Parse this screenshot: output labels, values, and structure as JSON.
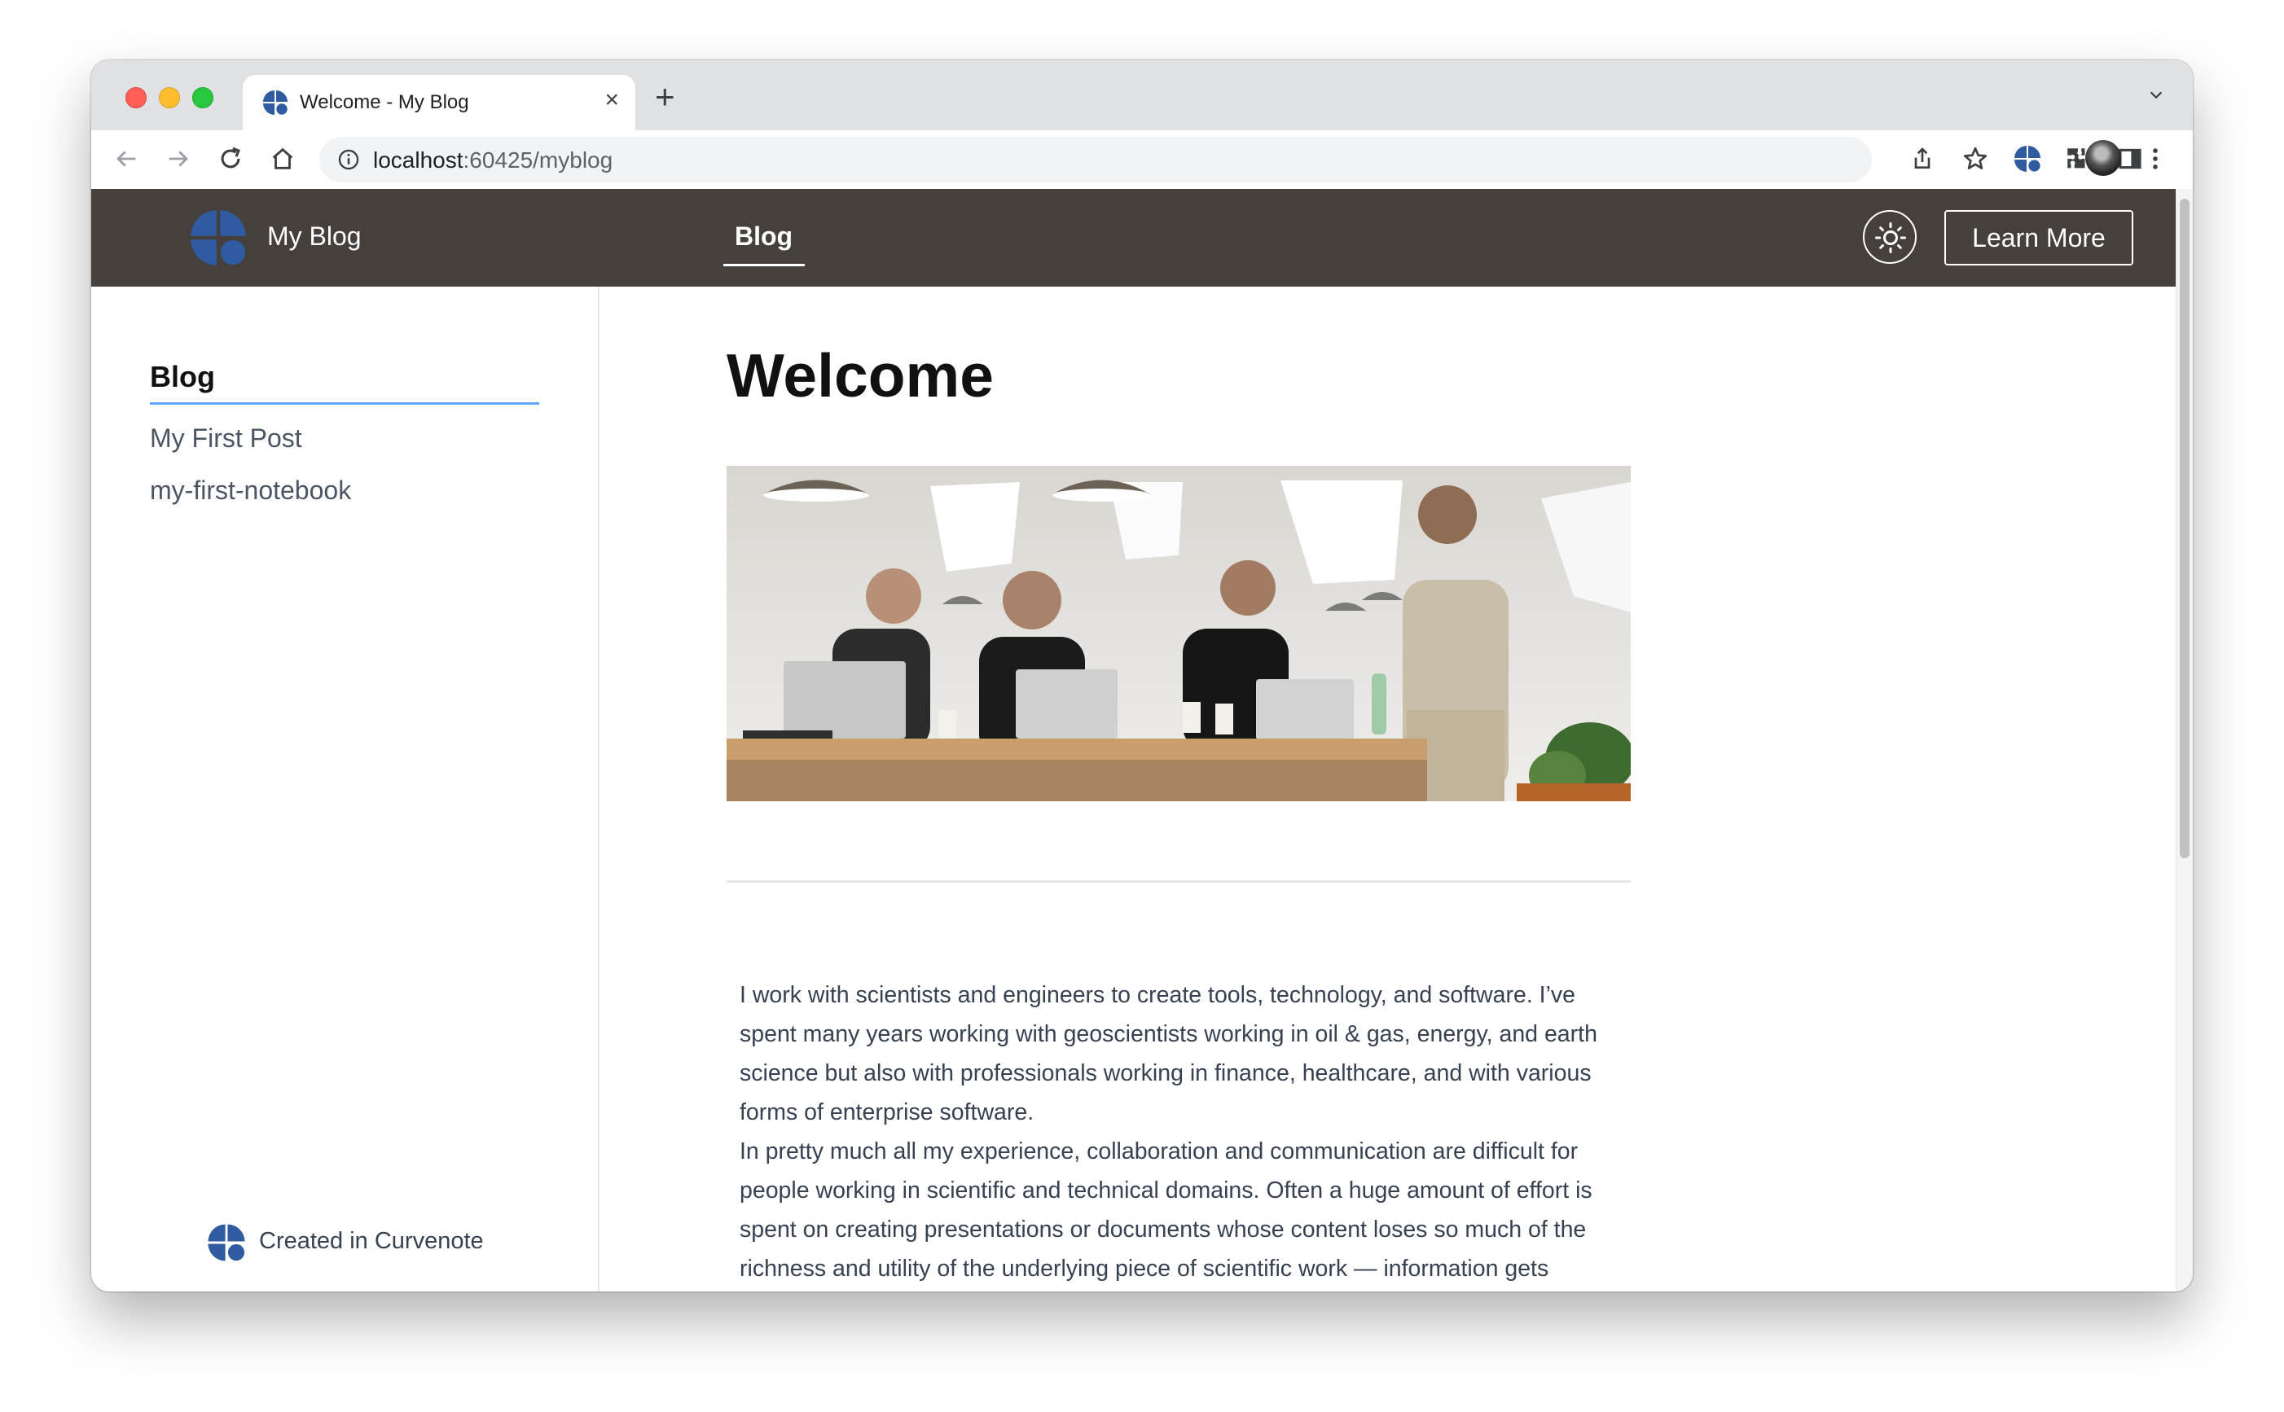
{
  "browser": {
    "tab_title": "Welcome - My Blog",
    "url_host": "localhost",
    "url_path": ":60425/myblog",
    "new_tab_label": "+",
    "close_tab_label": "×"
  },
  "site": {
    "brand_name": "My Blog",
    "nav_items": [
      {
        "label": "Blog",
        "active": true
      }
    ],
    "learn_more_label": "Learn More"
  },
  "sidebar": {
    "heading": "Blog",
    "items": [
      {
        "label": "My First Post"
      },
      {
        "label": "my-first-notebook"
      }
    ],
    "footer": "Created in Curvenote"
  },
  "article": {
    "title": "Welcome",
    "paragraphs": [
      "I work with scientists and engineers to create tools, technology, and software. I’ve spent many years working with geoscientists working in oil & gas, energy, and earth science but also with professionals working in finance, healthcare, and with various forms of enterprise software.",
      "In pretty much all my experience, collaboration and communication are difficult for people working in scientific and technical domains. Often a huge amount of effort is spent on creating presentations or documents whose content loses so much of the richness and utility of the underlying piece of scientific work — information gets"
    ]
  },
  "icons": {
    "favicon": "curvenote-logo-icon",
    "theme_toggle": "sun-icon",
    "profile": "profile-avatar"
  },
  "colors": {
    "navbar": "#45403c",
    "accent": "#60a5fa",
    "logo_blue": "#2f5ba0"
  }
}
